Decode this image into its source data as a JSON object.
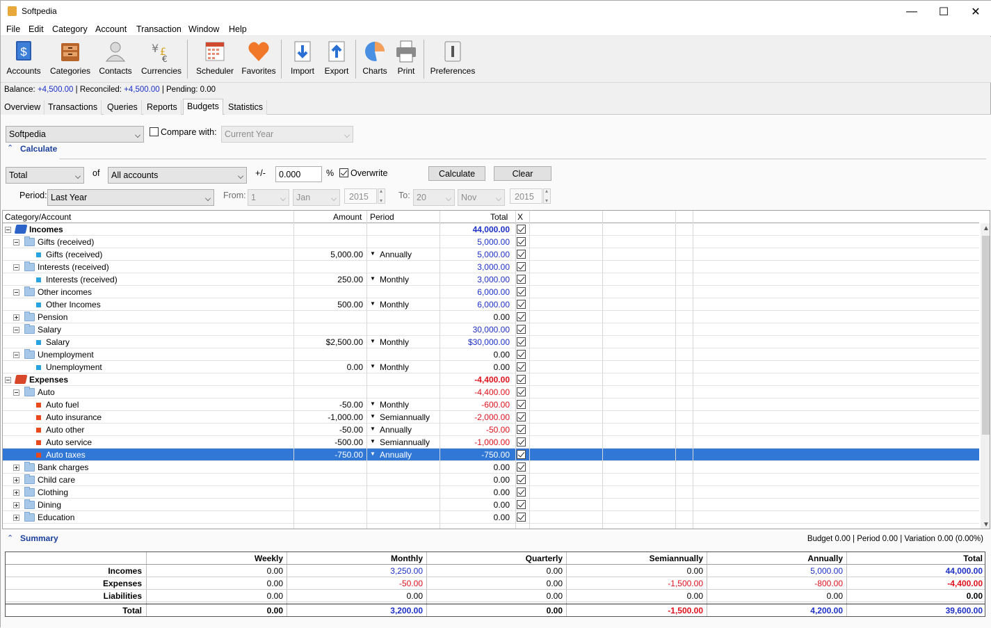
{
  "app_title": "Softpedia",
  "menu": [
    "File",
    "Edit",
    "Category",
    "Account",
    "Transaction",
    "Window",
    "Help"
  ],
  "toolbar": [
    {
      "label": "Accounts",
      "icon": "accounts-icon"
    },
    {
      "label": "Categories",
      "icon": "categories-icon"
    },
    {
      "label": "Contacts",
      "icon": "contacts-icon"
    },
    {
      "label": "Currencies",
      "icon": "currencies-icon"
    },
    {
      "label": "Scheduler",
      "icon": "scheduler-icon"
    },
    {
      "label": "Favorites",
      "icon": "favorites-icon"
    },
    {
      "label": "Import",
      "icon": "import-icon"
    },
    {
      "label": "Export",
      "icon": "export-icon"
    },
    {
      "label": "Charts",
      "icon": "charts-icon"
    },
    {
      "label": "Print",
      "icon": "print-icon"
    },
    {
      "label": "Preferences",
      "icon": "preferences-icon"
    }
  ],
  "status": {
    "balance_label": "Balance:",
    "balance": "+4,500.00",
    "reconciled_label": "| Reconciled:",
    "reconciled": "+4,500.00",
    "pending": "| Pending: 0.00"
  },
  "tabs": [
    "Overview",
    "Transactions",
    "Queries",
    "Reports",
    "Budgets",
    "Statistics"
  ],
  "budget": {
    "name": "Softpedia",
    "compare_label": "Compare with:",
    "compare_value": "Current Year",
    "calculate_link": "Calculate",
    "mode": "Total",
    "of_label": "of",
    "accounts": "All accounts",
    "pm_label": "+/-",
    "percent_value": "0.000",
    "percent_sign": "%",
    "overwrite_label": "Overwrite",
    "calculate_btn": "Calculate",
    "clear_btn": "Clear",
    "period_label": "Period:",
    "period_value": "Last Year",
    "from_label": "From:",
    "from_day": "1",
    "from_month": "Jan",
    "from_year": "2015",
    "to_label": "To:",
    "to_day": "20",
    "to_month": "Nov",
    "to_year": "2015"
  },
  "grid": {
    "headers": {
      "category": "Category/Account",
      "amount": "Amount",
      "period": "Period",
      "total": "Total",
      "x": "X"
    },
    "rows": [
      {
        "label": "Incomes",
        "amount": "",
        "period": "",
        "total": "44,000.00"
      },
      {
        "label": "Gifts (received)",
        "amount": "",
        "period": "",
        "total": "5,000.00"
      },
      {
        "label": "Gifts (received)",
        "amount": "5,000.00",
        "period": "Annually",
        "total": "5,000.00"
      },
      {
        "label": "Interests (received)",
        "amount": "",
        "period": "",
        "total": "3,000.00"
      },
      {
        "label": "Interests (received)",
        "amount": "250.00",
        "period": "Monthly",
        "total": "3,000.00"
      },
      {
        "label": "Other incomes",
        "amount": "",
        "period": "",
        "total": "6,000.00"
      },
      {
        "label": "Other Incomes",
        "amount": "500.00",
        "period": "Monthly",
        "total": "6,000.00"
      },
      {
        "label": "Pension",
        "amount": "",
        "period": "",
        "total": "0.00"
      },
      {
        "label": "Salary",
        "amount": "",
        "period": "",
        "total": "30,000.00"
      },
      {
        "label": "Salary",
        "amount": "$2,500.00",
        "period": "Monthly",
        "total": "$30,000.00"
      },
      {
        "label": "Unemployment",
        "amount": "",
        "period": "",
        "total": "0.00"
      },
      {
        "label": "Unemployment",
        "amount": "0.00",
        "period": "Monthly",
        "total": "0.00"
      },
      {
        "label": "Expenses",
        "amount": "",
        "period": "",
        "total": "-4,400.00"
      },
      {
        "label": "Auto",
        "amount": "",
        "period": "",
        "total": "-4,400.00"
      },
      {
        "label": "Auto fuel",
        "amount": "-50.00",
        "period": "Monthly",
        "total": "-600.00"
      },
      {
        "label": "Auto insurance",
        "amount": "-1,000.00",
        "period": "Semiannually",
        "total": "-2,000.00"
      },
      {
        "label": "Auto other",
        "amount": "-50.00",
        "period": "Annually",
        "total": "-50.00"
      },
      {
        "label": "Auto service",
        "amount": "-500.00",
        "period": "Semiannually",
        "total": "-1,000.00"
      },
      {
        "label": "Auto taxes",
        "amount": "-750.00",
        "period": "Annually",
        "total": "-750.00"
      },
      {
        "label": "Bank charges",
        "amount": "",
        "period": "",
        "total": "0.00"
      },
      {
        "label": "Child care",
        "amount": "",
        "period": "",
        "total": "0.00"
      },
      {
        "label": "Clothing",
        "amount": "",
        "period": "",
        "total": "0.00"
      },
      {
        "label": "Dining",
        "amount": "",
        "period": "",
        "total": "0.00"
      },
      {
        "label": "Education",
        "amount": "",
        "period": "",
        "total": "0.00"
      }
    ]
  },
  "summary": {
    "title": "Summary",
    "stats": "Budget 0.00 | Period 0.00 | Variation 0.00 (0.00%)",
    "headers": [
      "Weekly",
      "Monthly",
      "Quarterly",
      "Semiannually",
      "Annually",
      "Total"
    ],
    "rows": [
      {
        "label": "Incomes",
        "values": [
          "0.00",
          "3,250.00",
          "0.00",
          "0.00",
          "5,000.00",
          "44,000.00"
        ]
      },
      {
        "label": "Expenses",
        "values": [
          "0.00",
          "-50.00",
          "0.00",
          "-1,500.00",
          "-800.00",
          "-4,400.00"
        ]
      },
      {
        "label": "Liabilities",
        "values": [
          "0.00",
          "0.00",
          "0.00",
          "0.00",
          "0.00",
          "0.00"
        ]
      },
      {
        "label": "Total",
        "values": [
          "0.00",
          "3,200.00",
          "0.00",
          "-1,500.00",
          "4,200.00",
          "39,600.00"
        ]
      }
    ]
  },
  "colors": {
    "blue": "#1b2fc8",
    "red": "#e0101a",
    "selection": "#3178d6"
  }
}
